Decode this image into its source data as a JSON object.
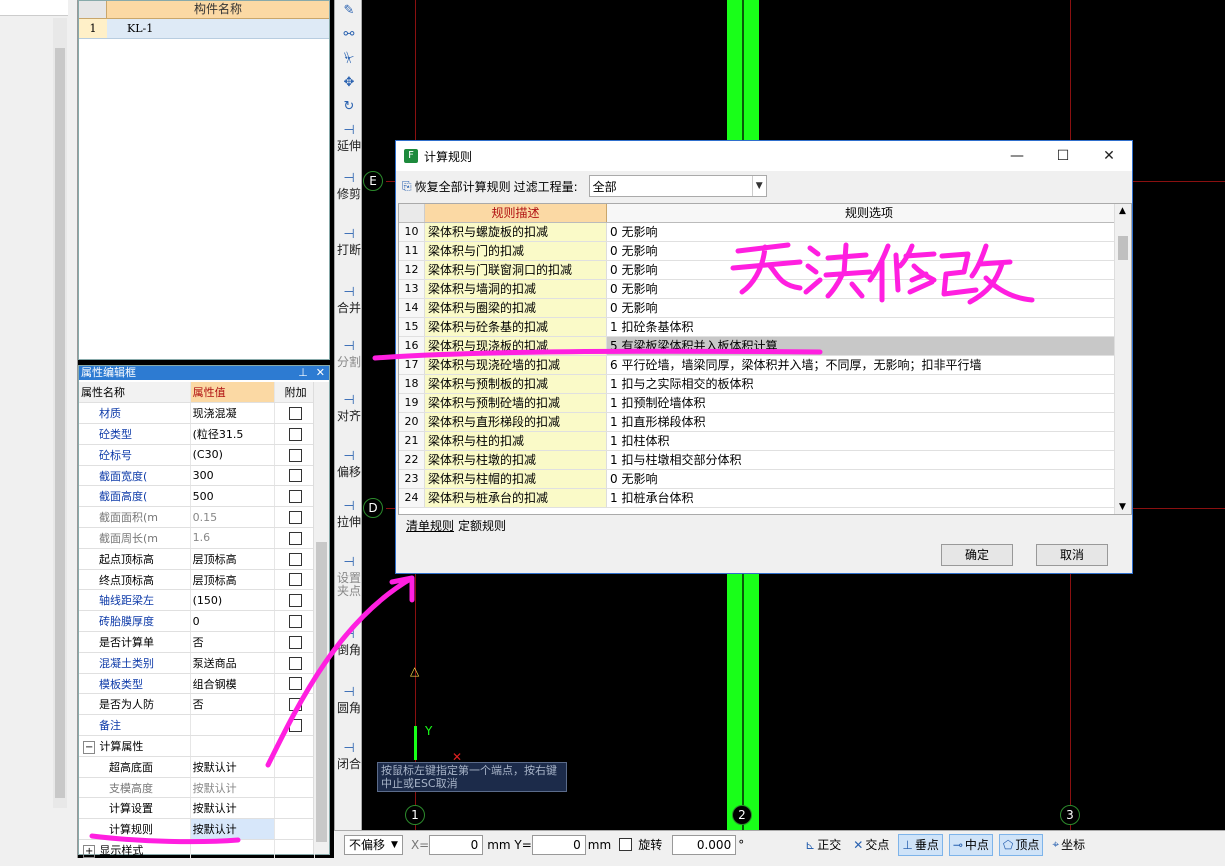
{
  "component_list": {
    "header": "构件名称",
    "rows": [
      {
        "index": "1",
        "name": "KL-1"
      }
    ]
  },
  "property_panel": {
    "title": "属性编辑框",
    "pin_icon": "pin-icon",
    "close_icon": "close-icon",
    "columns": [
      "属性名称",
      "属性值",
      "附加"
    ],
    "rows": [
      {
        "name": "材质",
        "value": "现浇混凝"
      },
      {
        "name": "砼类型",
        "value": "(粒径31.5"
      },
      {
        "name": "砼标号",
        "value": "(C30)"
      },
      {
        "name": "截面宽度(",
        "value": "300"
      },
      {
        "name": "截面高度(",
        "value": "500"
      },
      {
        "name": "截面面积(m",
        "value": "0.15"
      },
      {
        "name": "截面周长(m",
        "value": "1.6"
      },
      {
        "name": "起点顶标高",
        "value": "层顶标高"
      },
      {
        "name": "终点顶标高",
        "value": "层顶标高"
      },
      {
        "name": "轴线距梁左",
        "value": "(150)"
      },
      {
        "name": "砖胎膜厚度",
        "value": "0"
      },
      {
        "name": "是否计算单",
        "value": "否"
      },
      {
        "name": "混凝土类别",
        "value": "泵送商品"
      },
      {
        "name": "模板类型",
        "value": "组合钢模"
      },
      {
        "name": "是否为人防",
        "value": "否"
      },
      {
        "name": "备注",
        "value": ""
      }
    ],
    "calc_group": "计算属性",
    "calc_rows": [
      {
        "name": "超高底面",
        "value": "按默认计"
      },
      {
        "name": "支模高度",
        "value": "按默认计"
      },
      {
        "name": "计算设置",
        "value": "按默认计"
      },
      {
        "name": "计算规则",
        "value": "按默认计"
      }
    ],
    "display_group": "显示样式"
  },
  "toolbar": {
    "items": [
      "延伸",
      "修剪",
      "打断",
      "合并",
      "分割",
      "对齐",
      "偏移",
      "拉伸",
      "设置夹点",
      "倒角",
      "圆角",
      "闭合"
    ]
  },
  "canvas": {
    "axis_labels": [
      "E",
      "D",
      "1",
      "2",
      "3"
    ],
    "ucs_y": "Y",
    "tooltip": "按鼠标左键指定第一个端点，按右键中止或ESC取消"
  },
  "dialog": {
    "title": "计算规则",
    "restore_label": "恢复全部计算规则",
    "filter_label": "过滤工程量:",
    "filter_value": "全部",
    "columns": [
      "规则描述",
      "规则选项"
    ],
    "rows": [
      {
        "no": "10",
        "desc": "梁体积与螺旋板的扣减",
        "opt": "0 无影响"
      },
      {
        "no": "11",
        "desc": "梁体积与门的扣减",
        "opt": "0 无影响"
      },
      {
        "no": "12",
        "desc": "梁体积与门联窗洞口的扣减",
        "opt": "0 无影响"
      },
      {
        "no": "13",
        "desc": "梁体积与墙洞的扣减",
        "opt": "0 无影响"
      },
      {
        "no": "14",
        "desc": "梁体积与圈梁的扣减",
        "opt": "0 无影响"
      },
      {
        "no": "15",
        "desc": "梁体积与砼条基的扣减",
        "opt": "1 扣砼条基体积"
      },
      {
        "no": "16",
        "desc": "梁体积与现浇板的扣减",
        "opt": "5 有梁板梁体积并入板体积计算"
      },
      {
        "no": "17",
        "desc": "梁体积与现浇砼墙的扣减",
        "opt": "6 平行砼墙，墙梁同厚，梁体积并入墙；不同厚，无影响；扣非平行墙"
      },
      {
        "no": "18",
        "desc": "梁体积与预制板的扣减",
        "opt": "1 扣与之实际相交的板体积"
      },
      {
        "no": "19",
        "desc": "梁体积与预制砼墙的扣减",
        "opt": "1  扣预制砼墙体积"
      },
      {
        "no": "20",
        "desc": "梁体积与直形梯段的扣减",
        "opt": "1 扣直形梯段体积"
      },
      {
        "no": "21",
        "desc": "梁体积与柱的扣减",
        "opt": "1 扣柱体积"
      },
      {
        "no": "22",
        "desc": "梁体积与柱墩的扣减",
        "opt": "1 扣与柱墩相交部分体积"
      },
      {
        "no": "23",
        "desc": "梁体积与柱帽的扣减",
        "opt": "0 无影响"
      },
      {
        "no": "24",
        "desc": "梁体积与桩承台的扣减",
        "opt": "1 扣桩承台体积"
      }
    ],
    "tabs": [
      "清单规则",
      "定额规则"
    ],
    "ok": "确定",
    "cancel": "取消"
  },
  "statusbar": {
    "offset_mode": "不偏移",
    "x_label": "X=",
    "x_value": "0",
    "y_label": "mm Y=",
    "y_value": "0",
    "unit": "mm",
    "rotate_label": "旋转",
    "rotate_value": "0.000",
    "degree": "°",
    "snap_buttons": [
      {
        "label": "正交",
        "icon": "orthogonal-icon",
        "on": false
      },
      {
        "label": "交点",
        "icon": "intersection-icon",
        "on": false
      },
      {
        "label": "垂点",
        "icon": "perpendicular-icon",
        "on": true
      },
      {
        "label": "中点",
        "icon": "midpoint-icon",
        "on": true
      },
      {
        "label": "顶点",
        "icon": "vertex-icon",
        "on": true
      },
      {
        "label": "坐标",
        "icon": "coordinate-icon",
        "on": false
      }
    ]
  },
  "annotation": {
    "handwritten_text": "无法修改",
    "color": "#ff1fe0"
  }
}
